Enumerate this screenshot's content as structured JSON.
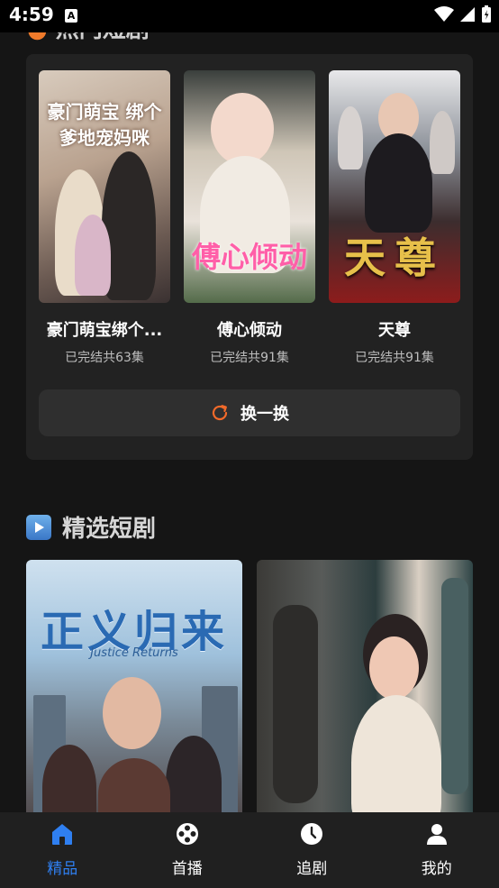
{
  "status_bar": {
    "time": "4:59",
    "notification_icon": "A"
  },
  "hot_section": {
    "title_partial": "热门短剧",
    "items": [
      {
        "name": "豪门萌宝绑个...",
        "episodes": "已完结共63集",
        "poster_text": "豪门萌宝 绑个爹地宠妈咪"
      },
      {
        "name": "傅心倾动",
        "episodes": "已完结共91集",
        "poster_text": "傅心倾动"
      },
      {
        "name": "天尊",
        "episodes": "已完结共91集",
        "poster_text": "天尊"
      }
    ],
    "swap_label": "换一换"
  },
  "featured_section": {
    "title": "精选短剧",
    "cards": [
      {
        "poster_title": "正义归来",
        "poster_subtitle": "Justice Returns"
      },
      {
        "poster_title": ""
      }
    ]
  },
  "bottom_nav": {
    "items": [
      {
        "label": "精品",
        "icon": "home-icon",
        "active": true
      },
      {
        "label": "首播",
        "icon": "film-reel-icon",
        "active": false
      },
      {
        "label": "追剧",
        "icon": "clock-icon",
        "active": false
      },
      {
        "label": "我的",
        "icon": "user-icon",
        "active": false
      }
    ]
  },
  "colors": {
    "accent": "#2f7ff0",
    "swap_icon": "#f26a2a",
    "background": "#151515",
    "panel": "#222222"
  }
}
